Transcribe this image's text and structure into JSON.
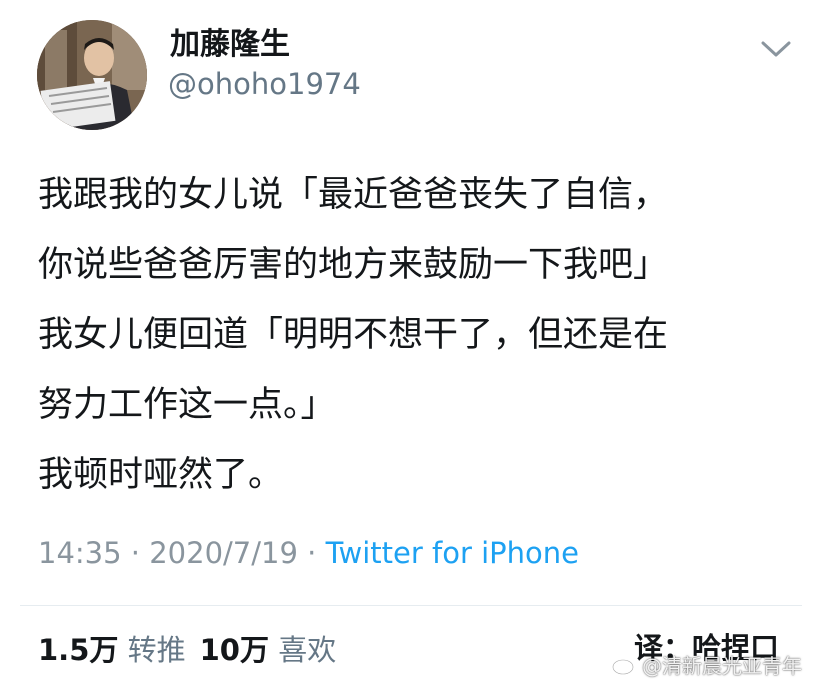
{
  "user": {
    "display_name": "加藤隆生",
    "handle": "@ohoho1974"
  },
  "tweet": {
    "lines": [
      "我跟我的女儿说「最近爸爸丧失了自信，",
      "你说些爸爸厉害的地方来鼓励一下我吧」",
      "我女儿便回道「明明不想干了，但还是在",
      "努力工作这一点。」",
      "我顿时哑然了。"
    ]
  },
  "meta": {
    "time": "14:35",
    "separator": "·",
    "date": "2020/7/19",
    "source": "Twitter for iPhone"
  },
  "stats": {
    "retweets_count": "1.5万",
    "retweets_label": "转推",
    "likes_count": "10万",
    "likes_label": "喜欢"
  },
  "translator": "译：哈捏口",
  "watermark": "@清新晨光亚青年",
  "icons": {
    "caret": "chevron-down-icon",
    "watermark": "weibo-icon"
  },
  "colors": {
    "text": "#14171a",
    "secondary": "#657786",
    "meta": "#8a959e",
    "link": "#1da1f2"
  }
}
